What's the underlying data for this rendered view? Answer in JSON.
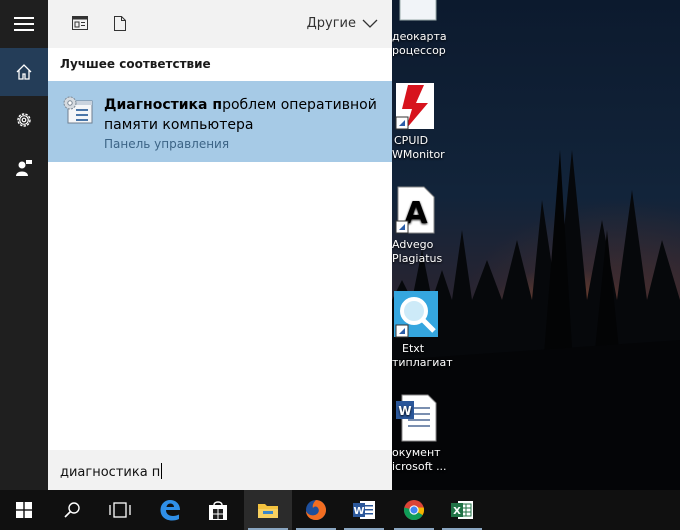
{
  "toolbar": {
    "others_label": "Другие"
  },
  "search": {
    "section_label": "Лучшее соответствие",
    "result": {
      "title_bold": "Диагностика п",
      "title_rest": "роблем оперативной памяти компьютера",
      "subtitle": "Панель управления"
    },
    "query": "диагностика п"
  },
  "desktop": {
    "icons": [
      {
        "line1": "деокарта",
        "line2": "роцессор"
      },
      {
        "line1": "CPUID",
        "line2": "WMonitor"
      },
      {
        "line1": "Advego",
        "line2": "Plagiatus"
      },
      {
        "line1": "Etxt",
        "line2": "типлагиат"
      },
      {
        "line1": "окумент",
        "line2": "icrosoft ..."
      }
    ]
  },
  "taskbar": {
    "items": [
      "start",
      "search",
      "task-view",
      "edge",
      "store",
      "file-explorer",
      "firefox",
      "word",
      "chrome",
      "excel"
    ]
  },
  "colors": {
    "rail": "#1f1f1f",
    "rail_active": "#243d58",
    "result_highlight": "#a6cae6",
    "subtitle": "#3c6486",
    "taskbar": "#101010"
  }
}
